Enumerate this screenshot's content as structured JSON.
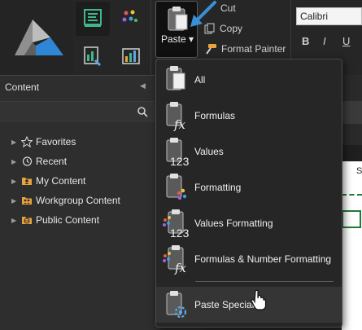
{
  "ribbon": {
    "quick_icons": [
      "book-grid-icon",
      "dots-palette-icon",
      "chart-tool-icon",
      "chart-edit-icon"
    ],
    "clipboard": {
      "paste_label": "Paste",
      "paste_arrow": "▾",
      "cut_label": "Cut",
      "copy_label": "Copy",
      "format_painter_label": "Format Painter"
    },
    "font": {
      "name": "Calibri",
      "bold": "B",
      "italic": "I",
      "underline": "U"
    }
  },
  "content_panel": {
    "title": "Content",
    "collapse_glyph": "◀",
    "tree": [
      {
        "label": "Favorites",
        "icon": "star-icon"
      },
      {
        "label": "Recent",
        "icon": "history-icon"
      },
      {
        "label": "My Content",
        "icon": "user-folder-icon"
      },
      {
        "label": "Workgroup Content",
        "icon": "group-folder-icon"
      },
      {
        "label": "Public Content",
        "icon": "globe-folder-icon"
      }
    ]
  },
  "sheet": {
    "cell_text": "S"
  },
  "paste_menu": {
    "items": [
      {
        "label": "All"
      },
      {
        "label": "Formulas",
        "badge": "fx"
      },
      {
        "label": "Values",
        "badge": "123"
      },
      {
        "label": "Formatting"
      },
      {
        "label": "Values Formatting",
        "badge": "123"
      },
      {
        "label": "Formulas & Number Formatting",
        "badge": "fx"
      },
      {
        "label": "Paste Special"
      }
    ]
  },
  "colors": {
    "accent_blue": "#3a8fd6",
    "accent_green": "#1e7b3b",
    "folder_orange": "#e8a33d"
  }
}
